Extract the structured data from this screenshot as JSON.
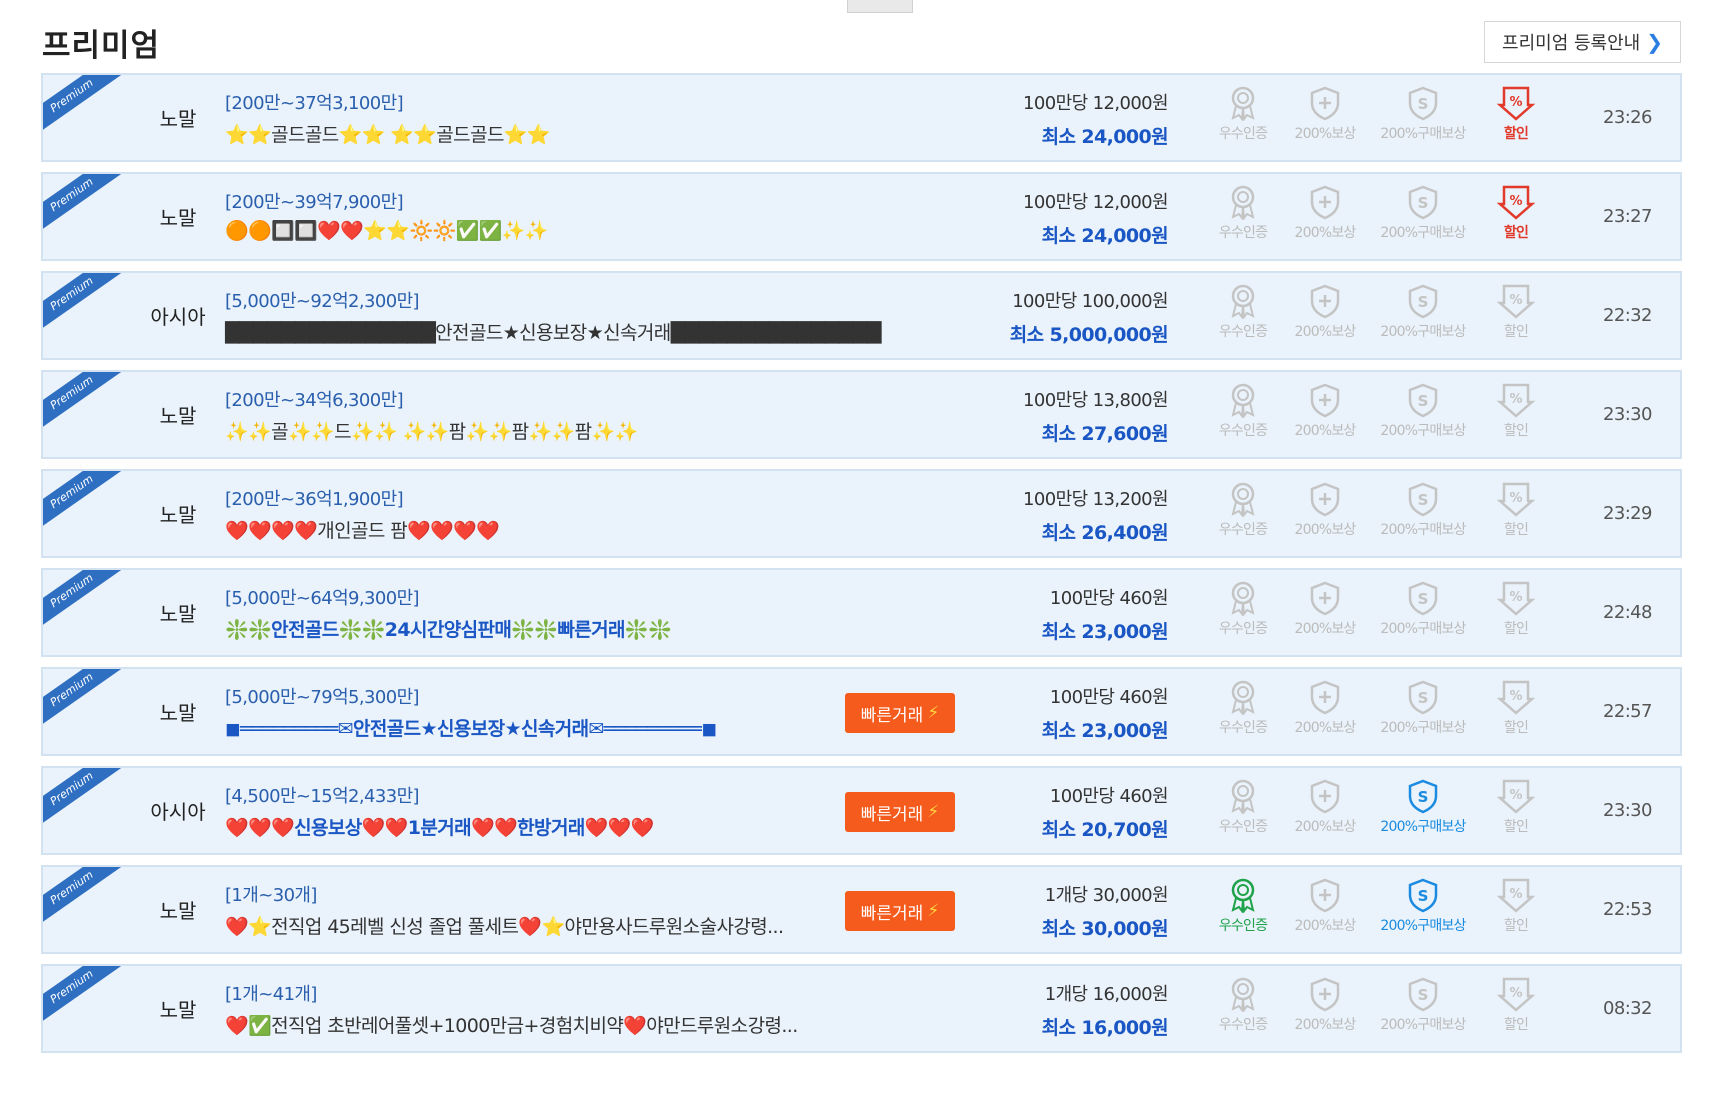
{
  "header": {
    "title": "프리미엄",
    "register_label": "프리미엄 등록안내",
    "register_chevron": "❯"
  },
  "ribbon_label": "Premium",
  "fast_label": "빠른거래",
  "fast_bolt": "⚡",
  "badge_labels": [
    "우수인증",
    "200%보상",
    "200%구매보상",
    "할인"
  ],
  "colors": {
    "accent_blue": "#1a56c4",
    "row_bg": "#eaf3fb",
    "fast_orange": "#f45b1d",
    "green": "#1fa24a",
    "red": "#e23a2a"
  },
  "rows": [
    {
      "server": "노말",
      "range": "[200만~37억3,100만]",
      "title": "⭐⭐골드골드⭐⭐ ⭐⭐골드골드⭐⭐",
      "title_blue": false,
      "fast": false,
      "rate": "100만당 12,000원",
      "min": "최소 24,000원",
      "badges": [
        false,
        false,
        false,
        true
      ],
      "time": "23:26"
    },
    {
      "server": "노말",
      "range": "[200만~39억7,900만]",
      "title": "🟠🟠🔲🔲❤️❤️⭐⭐🔆🔆✅✅✨✨",
      "title_blue": false,
      "fast": false,
      "rate": "100만당 12,000원",
      "min": "최소 24,000원",
      "badges": [
        false,
        false,
        false,
        true
      ],
      "time": "23:27"
    },
    {
      "server": "아시아",
      "range": "[5,000만~92억2,300만]",
      "title": "███████████████안전골드★신용보장★신속거래███████████████",
      "title_blue": false,
      "fast": false,
      "rate": "100만당 100,000원",
      "min": "최소 5,000,000원",
      "badges": [
        false,
        false,
        false,
        false
      ],
      "time": "22:32"
    },
    {
      "server": "노말",
      "range": "[200만~34억6,300만]",
      "title": "✨✨골✨✨드✨✨ ✨✨팜✨✨팜✨✨팜✨✨",
      "title_blue": false,
      "fast": false,
      "rate": "100만당 13,800원",
      "min": "최소 27,600원",
      "badges": [
        false,
        false,
        false,
        false
      ],
      "time": "23:30"
    },
    {
      "server": "노말",
      "range": "[200만~36억1,900만]",
      "title": "❤️❤️❤️❤️개인골드 팜❤️❤️❤️❤️",
      "title_blue": false,
      "fast": false,
      "rate": "100만당 13,200원",
      "min": "최소 26,400원",
      "badges": [
        false,
        false,
        false,
        false
      ],
      "time": "23:29"
    },
    {
      "server": "노말",
      "range": "[5,000만~64억9,300만]",
      "title": "❇️❇️안전골드❇️❇️24시간양심판매❇️❇️빠른거래❇️❇️",
      "title_blue": true,
      "fast": false,
      "rate": "100만당 460원",
      "min": "최소 23,000원",
      "badges": [
        false,
        false,
        false,
        false
      ],
      "time": "22:48"
    },
    {
      "server": "노말",
      "range": "[5,000만~79억5,300만]",
      "title": "◼═════════✉안전골드★신용보장★신속거래✉═════════◼",
      "title_blue": true,
      "fast": true,
      "rate": "100만당 460원",
      "min": "최소 23,000원",
      "badges": [
        false,
        false,
        false,
        false
      ],
      "time": "22:57"
    },
    {
      "server": "아시아",
      "range": "[4,500만~15억2,433만]",
      "title": "❤️❤️❤️신용보상❤️❤️1분거래❤️❤️한방거래❤️❤️❤️",
      "title_blue": true,
      "fast": true,
      "rate": "100만당 460원",
      "min": "최소 20,700원",
      "badges": [
        false,
        false,
        true,
        false
      ],
      "time": "23:30"
    },
    {
      "server": "노말",
      "range": "[1개~30개]",
      "title": "❤️⭐전직업 45레벨 신성 졸업 풀세트❤️⭐야만용사드루원소술사강령...",
      "title_blue": false,
      "fast": true,
      "rate": "1개당 30,000원",
      "min": "최소 30,000원",
      "badges": [
        true,
        false,
        true,
        false
      ],
      "time": "22:53"
    },
    {
      "server": "노말",
      "range": "[1개~41개]",
      "title": "❤️✅전직업 초반레어풀셋+1000만금+경험치비약❤️야만드루원소강령...",
      "title_blue": false,
      "fast": false,
      "rate": "1개당 16,000원",
      "min": "최소 16,000원",
      "badges": [
        false,
        false,
        false,
        false
      ],
      "time": "08:32"
    }
  ]
}
